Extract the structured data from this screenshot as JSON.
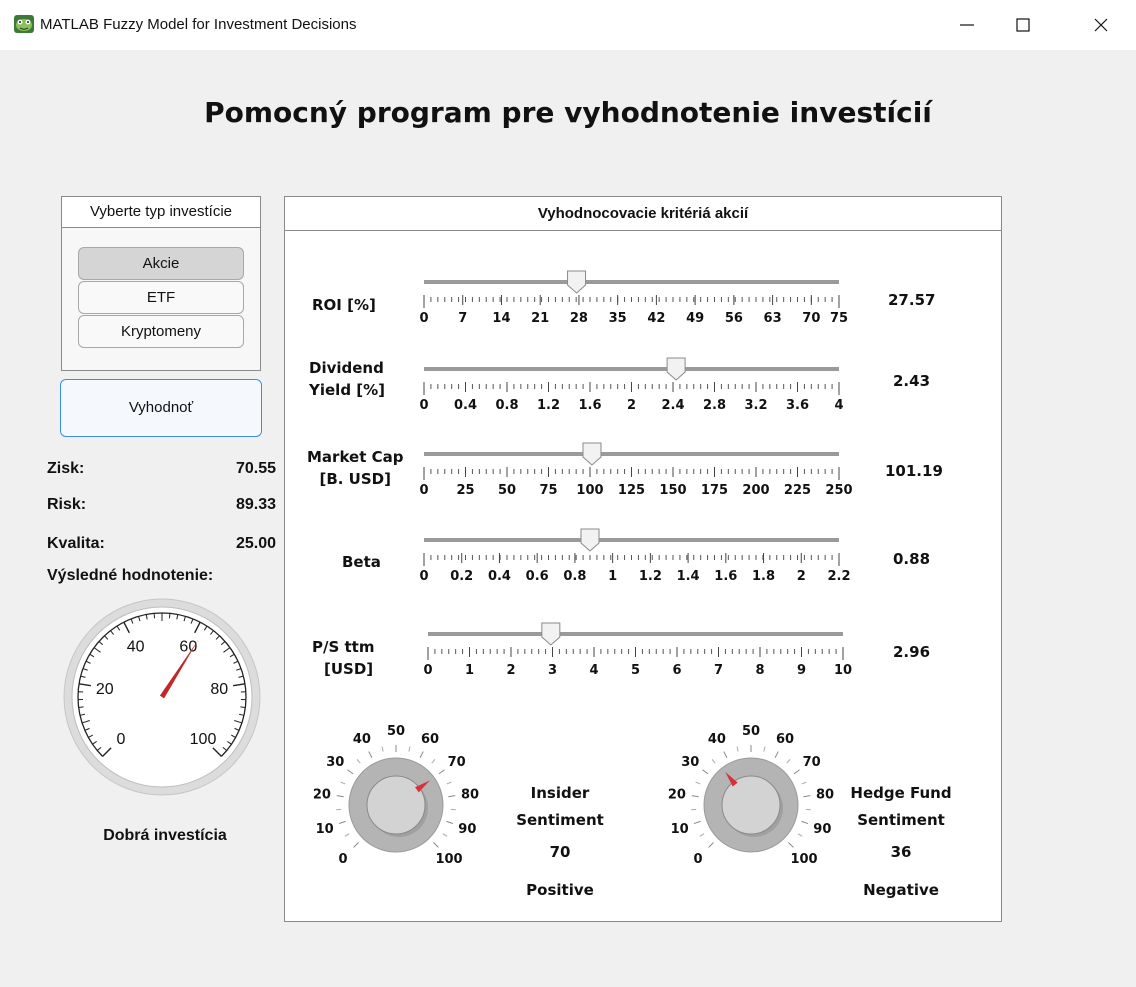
{
  "window": {
    "title": "MATLAB Fuzzy Model for Investment Decisions"
  },
  "heading": "Pomocný program pre vyhodnotenie investícií",
  "investment_type": {
    "title": "Vyberte typ investície",
    "options": [
      "Akcie",
      "ETF",
      "Kryptomeny"
    ],
    "selected": "Akcie"
  },
  "evaluate_button": "Vyhodnoť",
  "results": {
    "profit_label": "Zisk:",
    "profit_value": "70.55",
    "risk_label": "Risk:",
    "risk_value": "89.33",
    "quality_label": "Kvalita:",
    "quality_value": "25.00",
    "final_label": "Výsledné hodnotenie:",
    "gauge": {
      "min": 0,
      "max": 100,
      "value": 62,
      "tick_labels": [
        "0",
        "20",
        "40",
        "60",
        "80",
        "100"
      ],
      "needle_color": "#c0282a"
    },
    "verdict": "Dobrá investícia"
  },
  "criteria": {
    "title": "Vyhodnocovacie kritériá akcií",
    "sliders": [
      {
        "label_lines": [
          "ROI [%]"
        ],
        "min": 0,
        "max": 75,
        "value": 27.57,
        "value_text": "27.57",
        "ticks": [
          "0",
          "7",
          "14",
          "21",
          "28",
          "35",
          "42",
          "49",
          "56",
          "63",
          "70",
          "75"
        ]
      },
      {
        "label_lines": [
          "Dividend",
          "Yield [%]"
        ],
        "min": 0,
        "max": 4,
        "value": 2.43,
        "value_text": "2.43",
        "ticks": [
          "0",
          "0.4",
          "0.8",
          "1.2",
          "1.6",
          "2",
          "2.4",
          "2.8",
          "3.2",
          "3.6",
          "4"
        ]
      },
      {
        "label_lines": [
          "Market Cap",
          "[B. USD]"
        ],
        "min": 0,
        "max": 250,
        "value": 101.19,
        "value_text": "101.19",
        "ticks": [
          "0",
          "25",
          "50",
          "75",
          "100",
          "125",
          "150",
          "175",
          "200",
          "225",
          "250"
        ]
      },
      {
        "label_lines": [
          "Beta"
        ],
        "min": 0,
        "max": 2.2,
        "value": 0.88,
        "value_text": "0.88",
        "ticks": [
          "0",
          "0.2",
          "0.4",
          "0.6",
          "0.8",
          "1",
          "1.2",
          "1.4",
          "1.6",
          "1.8",
          "2",
          "2.2"
        ]
      },
      {
        "label_lines": [
          "P/S ttm",
          "[USD]"
        ],
        "min": 0,
        "max": 10,
        "value": 2.96,
        "value_text": "2.96",
        "ticks": [
          "0",
          "1",
          "2",
          "3",
          "4",
          "5",
          "6",
          "7",
          "8",
          "9",
          "10"
        ]
      }
    ],
    "knobs": [
      {
        "label_lines": [
          "Insider",
          "Sentiment"
        ],
        "value": 70,
        "value_text": "70",
        "status": "Positive",
        "min": 0,
        "max": 100,
        "ticks": [
          "0",
          "10",
          "20",
          "30",
          "40",
          "50",
          "60",
          "70",
          "80",
          "90",
          "100"
        ]
      },
      {
        "label_lines": [
          "Hedge Fund",
          "Sentiment"
        ],
        "value": 36,
        "value_text": "36",
        "status": "Negative",
        "min": 0,
        "max": 100,
        "ticks": [
          "0",
          "10",
          "20",
          "30",
          "40",
          "50",
          "60",
          "70",
          "80",
          "90",
          "100"
        ]
      }
    ],
    "pointer_color": "#d9313a"
  }
}
